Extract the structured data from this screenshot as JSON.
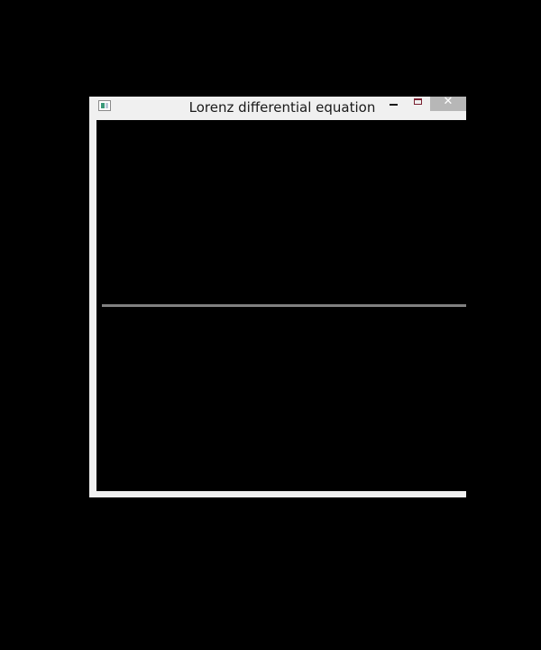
{
  "window": {
    "title": "Lorenz differential equation",
    "icon": "app-window-icon",
    "controls": {
      "minimize_icon": "minimize-icon",
      "maximize_icon": "maximize-icon",
      "close_icon": "close-icon",
      "close_glyph": "✕"
    }
  },
  "canvas": {
    "background": "#000000",
    "line_color": "#808080"
  }
}
